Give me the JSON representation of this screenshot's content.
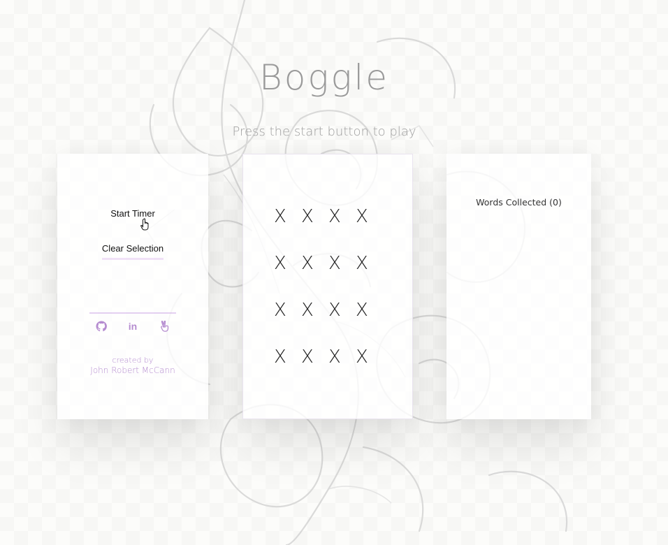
{
  "header": {
    "title": "Boggle",
    "subtitle": "Press the start button to play"
  },
  "controls": {
    "start_label": "Start Timer",
    "clear_label": "Clear Selection"
  },
  "social": {
    "github_icon": "github-icon",
    "linkedin_icon": "linkedin-icon",
    "linkedin_glyph": "in",
    "angellist_icon": "angellist-icon"
  },
  "credits": {
    "created_by": "created by",
    "author": "John Robert McCann"
  },
  "board": {
    "rows": [
      [
        "X",
        "X",
        "X",
        "X"
      ],
      [
        "X",
        "X",
        "X",
        "X"
      ],
      [
        "X",
        "X",
        "X",
        "X"
      ],
      [
        "X",
        "X",
        "X",
        "X"
      ]
    ]
  },
  "words": {
    "title": "Words Collected (0)"
  },
  "colors": {
    "accent": "#b58cd0",
    "title_gray": "#9a9a9a"
  }
}
